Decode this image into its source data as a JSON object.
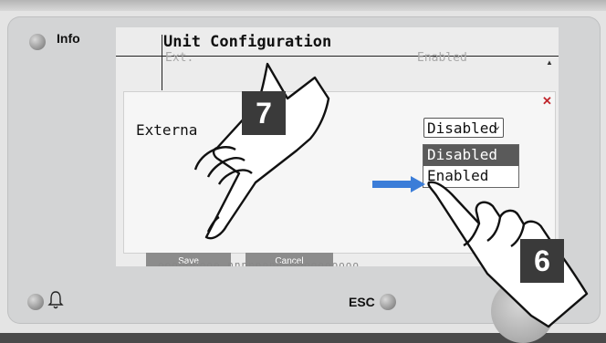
{
  "panel": {
    "info_label": "Info",
    "esc_label": "ESC",
    "bell_icon": "bell-icon"
  },
  "screen": {
    "title": "Unit Configuration",
    "ghost_top_left": "Ext.",
    "ghost_top_right": "Enabled",
    "ghost_bottom": "ooooooooo  nnnnnnnn  oooooooooo"
  },
  "dialog": {
    "field_label": "Externa",
    "select_value": "Disabled",
    "options": [
      "Disabled",
      "Enabled"
    ],
    "close_icon": "close-icon",
    "save_label": "Save",
    "cancel_label": "Cancel"
  },
  "annotations": {
    "step_left": "7",
    "step_right": "6",
    "arrow_icon": "arrow-right-icon",
    "hand_icon": "pointing-hand-icon",
    "arrow_color": "#3b7dd8",
    "badge_color": "#3a3a3a"
  }
}
